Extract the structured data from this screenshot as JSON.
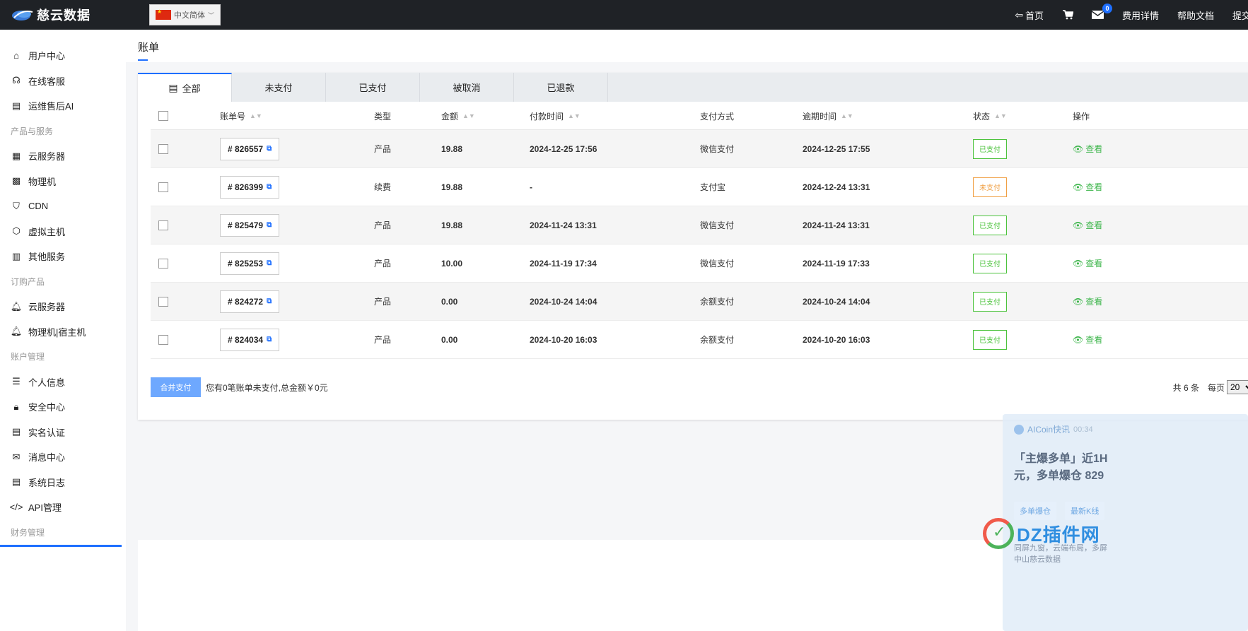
{
  "topbar": {
    "logo_text": "慈云数据",
    "language": "中文简体",
    "nav": {
      "home": "首页",
      "message_count": "0",
      "fees": "费用详情",
      "docs": "帮助文档",
      "submit": "提交"
    }
  },
  "sidebar": {
    "items": [
      {
        "type": "item",
        "label": "用户中心",
        "icon": "home-icon",
        "glyph": "⌂"
      },
      {
        "type": "item",
        "label": "在线客服",
        "icon": "support-icon",
        "glyph": "☊"
      },
      {
        "type": "item",
        "label": "运维售后AI",
        "icon": "list-icon",
        "glyph": "▤"
      },
      {
        "type": "group",
        "label": "产品与服务"
      },
      {
        "type": "item",
        "label": "云服务器",
        "icon": "grid-icon",
        "glyph": "▦"
      },
      {
        "type": "item",
        "label": "物理机",
        "icon": "server-icon",
        "glyph": "▩"
      },
      {
        "type": "item",
        "label": "CDN",
        "icon": "shield-icon",
        "glyph": "⛉"
      },
      {
        "type": "item",
        "label": "虚拟主机",
        "icon": "cube-icon",
        "glyph": "⬡"
      },
      {
        "type": "item",
        "label": "其他服务",
        "icon": "book-icon",
        "glyph": "▥"
      },
      {
        "type": "group",
        "label": "订购产品"
      },
      {
        "type": "item",
        "label": "云服务器",
        "icon": "bell-icon",
        "glyph": "🔔︎"
      },
      {
        "type": "item",
        "label": "物理机|宿主机",
        "icon": "bell-icon",
        "glyph": "🔔︎"
      },
      {
        "type": "group",
        "label": "账户管理"
      },
      {
        "type": "item",
        "label": "个人信息",
        "icon": "user-card-icon",
        "glyph": "☰"
      },
      {
        "type": "item",
        "label": "安全中心",
        "icon": "lock-icon",
        "glyph": "🔒︎"
      },
      {
        "type": "item",
        "label": "实名认证",
        "icon": "id-card-icon",
        "glyph": "▤"
      },
      {
        "type": "item",
        "label": "消息中心",
        "icon": "mail-icon",
        "glyph": "✉"
      },
      {
        "type": "item",
        "label": "系统日志",
        "icon": "file-icon",
        "glyph": "▤"
      },
      {
        "type": "item",
        "label": "API管理",
        "icon": "code-icon",
        "glyph": "</>"
      },
      {
        "type": "group",
        "label": "财务管理"
      }
    ]
  },
  "page": {
    "title": "账单"
  },
  "tabs": [
    "全部",
    "未支付",
    "已支付",
    "被取消",
    "已退款"
  ],
  "table": {
    "headers": {
      "bill_no": "账单号",
      "type": "类型",
      "amount": "金额",
      "pay_time": "付款时间",
      "pay_method": "支付方式",
      "due_time": "逾期时间",
      "status": "状态",
      "action": "操作"
    },
    "rows": [
      {
        "bill_no": "# 826557",
        "type": "产品",
        "amount": "19.88",
        "pay_time": "2024-12-25 17:56",
        "pay_method": "微信支付",
        "due_time": "2024-12-25 17:55",
        "status": "已支付",
        "paid": true,
        "action": "查看"
      },
      {
        "bill_no": "# 826399",
        "type": "续费",
        "amount": "19.88",
        "pay_time": "-",
        "pay_method": "支付宝",
        "due_time": "2024-12-24 13:31",
        "status": "未支付",
        "paid": false,
        "action": "查看"
      },
      {
        "bill_no": "# 825479",
        "type": "产品",
        "amount": "19.88",
        "pay_time": "2024-11-24 13:31",
        "pay_method": "微信支付",
        "due_time": "2024-11-24 13:31",
        "status": "已支付",
        "paid": true,
        "action": "查看"
      },
      {
        "bill_no": "# 825253",
        "type": "产品",
        "amount": "10.00",
        "pay_time": "2024-11-19 17:34",
        "pay_method": "微信支付",
        "due_time": "2024-11-19 17:33",
        "status": "已支付",
        "paid": true,
        "action": "查看"
      },
      {
        "bill_no": "# 824272",
        "type": "产品",
        "amount": "0.00",
        "pay_time": "2024-10-24 14:04",
        "pay_method": "余额支付",
        "due_time": "2024-10-24 14:04",
        "status": "已支付",
        "paid": true,
        "action": "查看"
      },
      {
        "bill_no": "# 824034",
        "type": "产品",
        "amount": "0.00",
        "pay_time": "2024-10-20 16:03",
        "pay_method": "余额支付",
        "due_time": "2024-10-20 16:03",
        "status": "已支付",
        "paid": true,
        "action": "查看"
      }
    ]
  },
  "footer": {
    "merge_button": "合并支付",
    "note": "您有0笔账单未支付,总金额￥0元",
    "total": "共 6 条",
    "per_page_label": "每页",
    "per_page_value": "20"
  },
  "popup": {
    "source": "AICoin快讯",
    "time": "00:34",
    "headline_1": "「主爆多单」近1H",
    "headline_2": "元，多单爆仓 829",
    "tag_1": "多单爆仓",
    "tag_2": "最新K线",
    "sub_1": "同屏九窗，云端布局，多屏",
    "sub_2": "中山慈云数据"
  },
  "watermark": {
    "text": "DZ插件网"
  },
  "colors": {
    "accent": "#1e6fff",
    "paid": "#4cc33c",
    "unpaid": "#f0a044",
    "topbar": "#1f2226"
  }
}
